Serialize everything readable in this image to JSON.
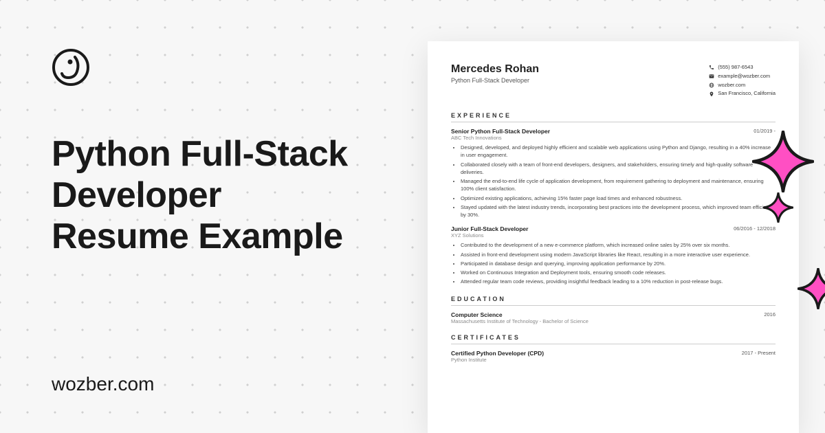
{
  "headline_line1": "Python Full-Stack",
  "headline_line2": "Developer",
  "headline_line3": "Resume Example",
  "site": "wozber.com",
  "resume": {
    "name": "Mercedes Rohan",
    "role": "Python Full-Stack Developer",
    "contact": {
      "phone": "(555) 987-6543",
      "email": "example@wozber.com",
      "web": "wozber.com",
      "location": "San Francisco, California"
    },
    "sections": {
      "experience": "EXPERIENCE",
      "education": "EDUCATION",
      "certificates": "CERTIFICATES"
    },
    "jobs": [
      {
        "title": "Senior Python Full-Stack Developer",
        "date": "01/2019 - ",
        "company": "ABC Tech Innovations",
        "bullets": [
          "Designed, developed, and deployed highly efficient and scalable web applications using Python and Django, resulting in a 40% increase in user engagement.",
          "Collaborated closely with a team of front-end developers, designers, and stakeholders, ensuring timely and high-quality software deliveries.",
          "Managed the end-to-end life cycle of application development, from requirement gathering to deployment and maintenance, ensuring 100% client satisfaction.",
          "Optimized existing applications, achieving 15% faster page load times and enhanced robustness.",
          "Stayed updated with the latest industry trends, incorporating best practices into the development process, which improved team efficiency by 30%."
        ]
      },
      {
        "title": "Junior Full-Stack Developer",
        "date": "06/2016 - 12/2018",
        "company": "XYZ Solutions",
        "bullets": [
          "Contributed to the development of a new e-commerce platform, which increased online sales by 25% over six months.",
          "Assisted in front-end development using modern JavaScript libraries like React, resulting in a more interactive user experience.",
          "Participated in database design and querying, improving application performance by 20%.",
          "Worked on Continuous Integration and Deployment tools, ensuring smooth code releases.",
          "Attended regular team code reviews, providing insightful feedback leading to a 10% reduction in post-release bugs."
        ]
      }
    ],
    "education": {
      "degree": "Computer Science",
      "school": "Massachusetts Institute of Technology - Bachelor of Science",
      "year": "2016"
    },
    "cert": {
      "name": "Certified Python Developer (CPD)",
      "issuer": "Python Institute",
      "date": "2017 - Present"
    }
  }
}
